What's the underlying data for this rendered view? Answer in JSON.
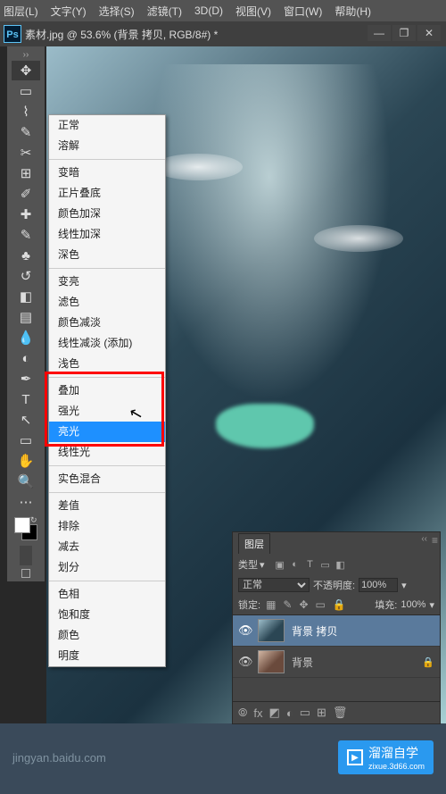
{
  "menubar": {
    "items": [
      "图层(L)",
      "文字(Y)",
      "选择(S)",
      "滤镜(T)",
      "3D(D)",
      "视图(V)",
      "窗口(W)",
      "帮助(H)"
    ]
  },
  "document": {
    "tab_title": "素材.jpg @ 53.6% (背景 拷贝, RGB/8#) *"
  },
  "win_controls": {
    "min": "—",
    "max": "❐",
    "close": "✕"
  },
  "tools": [
    {
      "name": "move-tool",
      "glyph": "✥",
      "active": true
    },
    {
      "name": "marquee-tool",
      "glyph": "▭"
    },
    {
      "name": "lasso-tool",
      "glyph": "⌇"
    },
    {
      "name": "quick-select-tool",
      "glyph": "✎"
    },
    {
      "name": "crop-tool",
      "glyph": "✂"
    },
    {
      "name": "frame-tool",
      "glyph": "⊞"
    },
    {
      "name": "eyedropper-tool",
      "glyph": "✐"
    },
    {
      "name": "patch-tool",
      "glyph": "✚"
    },
    {
      "name": "brush-tool",
      "glyph": "✎"
    },
    {
      "name": "stamp-tool",
      "glyph": "♣"
    },
    {
      "name": "history-brush-tool",
      "glyph": "↺"
    },
    {
      "name": "eraser-tool",
      "glyph": "◧"
    },
    {
      "name": "gradient-tool",
      "glyph": "▤"
    },
    {
      "name": "blur-tool",
      "glyph": "💧"
    },
    {
      "name": "dodge-tool",
      "glyph": "◐"
    },
    {
      "name": "pen-tool",
      "glyph": "✒"
    },
    {
      "name": "type-tool",
      "glyph": "T"
    },
    {
      "name": "path-select-tool",
      "glyph": "↖"
    },
    {
      "name": "shape-tool",
      "glyph": "▭"
    },
    {
      "name": "hand-tool",
      "glyph": "✋"
    },
    {
      "name": "zoom-tool",
      "glyph": "🔍"
    },
    {
      "name": "edit-toolbar",
      "glyph": "⋯"
    }
  ],
  "blend_menu": {
    "groups": [
      [
        "正常",
        "溶解"
      ],
      [
        "变暗",
        "正片叠底",
        "颜色加深",
        "线性加深",
        "深色"
      ],
      [
        "变亮",
        "滤色",
        "颜色减淡",
        "线性减淡 (添加)",
        "浅色"
      ],
      [
        "叠加",
        "强光",
        "亮光",
        "线性光"
      ],
      [
        "实色混合"
      ],
      [
        "差值",
        "排除",
        "减去",
        "划分"
      ],
      [
        "色相",
        "饱和度",
        "颜色",
        "明度"
      ]
    ],
    "hovered": "亮光"
  },
  "layers_panel": {
    "tabs": [
      "图层"
    ],
    "kind_label": "类型",
    "blend_mode_value": "正常",
    "opacity_label": "不透明度:",
    "opacity_value": "100%",
    "lock_label": "锁定:",
    "fill_label": "填充:",
    "fill_value": "100%",
    "layers": [
      {
        "name": "背景 拷贝",
        "selected": true,
        "locked": false
      },
      {
        "name": "背景",
        "selected": false,
        "locked": true
      }
    ]
  },
  "watermark": {
    "url": "jingyan.baidu.com",
    "logo_text": "溜溜自学",
    "logo_sub": "zixue.3d66.com"
  }
}
